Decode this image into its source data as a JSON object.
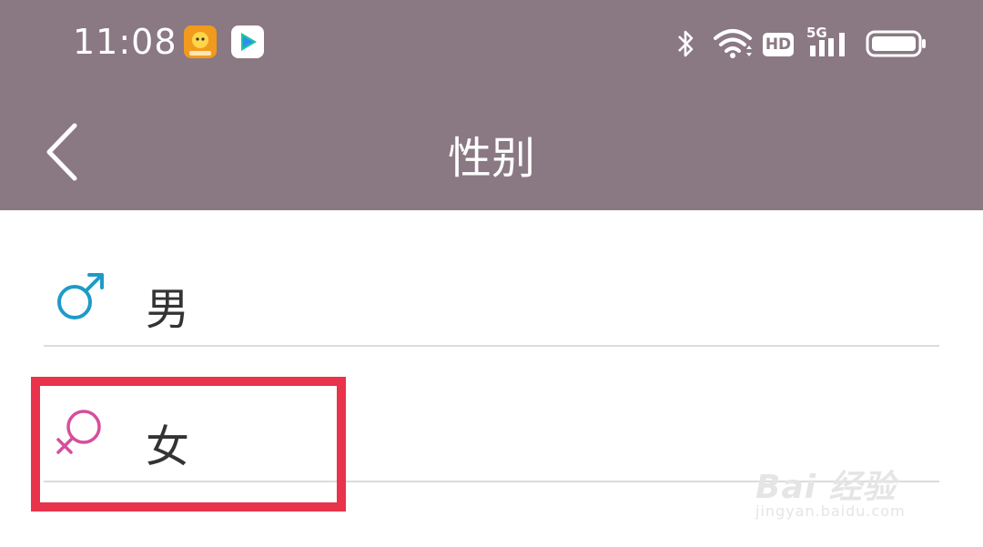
{
  "status_bar": {
    "time": "11:08",
    "network_label": "5G",
    "hd_label": "HD",
    "icons": [
      "app-icon-orange",
      "video-app-icon",
      "bluetooth-icon",
      "wifi-icon",
      "hd-icon",
      "signal-icon",
      "battery-icon"
    ]
  },
  "nav": {
    "title": "性别",
    "back_icon": "chevron-left-icon"
  },
  "options": [
    {
      "label": "男",
      "icon": "male-symbol-icon",
      "color": "#1e9bc8"
    },
    {
      "label": "女",
      "icon": "female-symbol-icon",
      "color": "#d64e9c"
    }
  ],
  "watermark": {
    "brand": "Bai 经验",
    "url": "jingyan.baidu.com"
  },
  "colors": {
    "header_bg": "#8a7883",
    "highlight": "#e8334a",
    "divider": "#dcdcdc"
  }
}
